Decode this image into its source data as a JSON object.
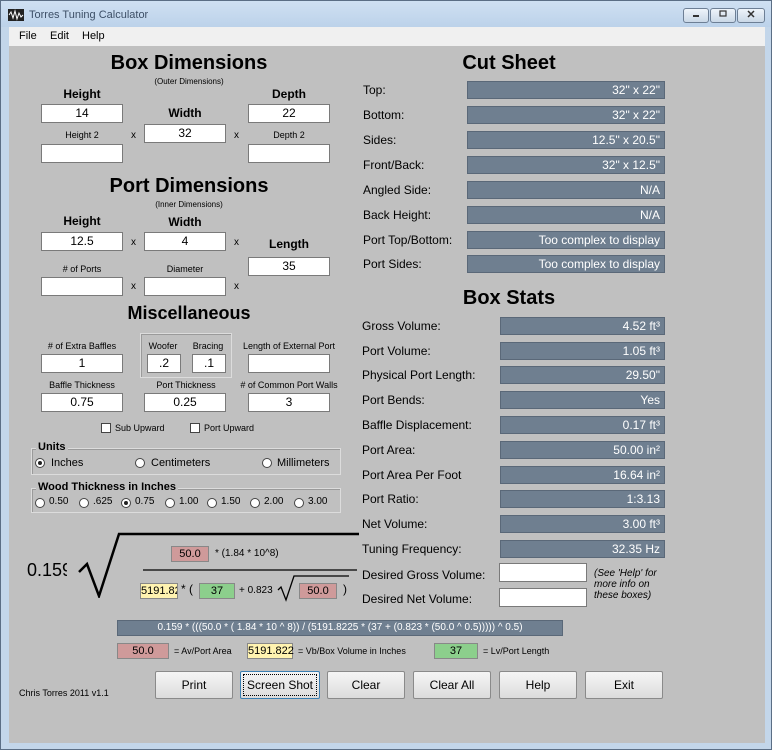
{
  "window": {
    "title": "Torres Tuning Calculator"
  },
  "menu": [
    "File",
    "Edit",
    "Help"
  ],
  "box": {
    "heading": "Box Dimensions",
    "subheading": "(Outer Dimensions)",
    "height_label": "Height",
    "height_value": "14",
    "width_label": "Width",
    "width_value": "32",
    "depth_label": "Depth",
    "depth_value": "22",
    "height2_label": "Height 2",
    "height2_value": "",
    "depth2_label": "Depth 2",
    "depth2_value": ""
  },
  "port": {
    "heading": "Port Dimensions",
    "subheading": "(Inner Dimensions)",
    "height_label": "Height",
    "height_value": "12.5",
    "width_label": "Width",
    "width_value": "4",
    "length_label": "Length",
    "length_value": "35",
    "num_ports_label": "# of Ports",
    "num_ports_value": "",
    "diameter_label": "Diameter",
    "diameter_value": ""
  },
  "misc": {
    "heading": "Miscellaneous",
    "extra_baffles_label": "# of Extra Baffles",
    "extra_baffles_value": "1",
    "woofer_label": "Woofer",
    "woofer_value": ".2",
    "bracing_label": "Bracing",
    "bracing_value": ".1",
    "ext_port_label": "Length of External Port",
    "ext_port_value": "",
    "baffle_thick_label": "Baffle Thickness",
    "baffle_thick_value": "0.75",
    "port_thick_label": "Port Thickness",
    "port_thick_value": "0.25",
    "common_walls_label": "# of Common Port Walls",
    "common_walls_value": "3",
    "sub_upward": "Sub Upward",
    "port_upward": "Port Upward"
  },
  "units": {
    "title": "Units",
    "options": [
      "Inches",
      "Centimeters",
      "Millimeters"
    ],
    "selected": "Inches"
  },
  "wood": {
    "title": "Wood Thickness in Inches",
    "options": [
      "0.50",
      ".625",
      "0.75",
      "1.00",
      "1.50",
      "2.00",
      "3.00"
    ],
    "selected": "0.75"
  },
  "formula": {
    "coef": "0.159",
    "av": "50.0",
    "const_text": "* (1.84 * 10^8)",
    "vb": "5191.822",
    "lv": "37",
    "mid_text": "+ 0.823",
    "av2": "50.0",
    "expression": "0.159 * (((50.0 * ( 1.84 * 10 ^ 8)) / (5191.8225 * (37 + (0.823 * (50.0 ^ 0.5))))) ^ 0.5)",
    "legend_av": "= Av/Port Area",
    "legend_vb": "= Vb/Box Volume in Inches",
    "legend_lv": "= Lv/Port Length"
  },
  "cut_sheet": {
    "heading": "Cut Sheet",
    "rows": [
      {
        "label": "Top:",
        "value": "32\" x 22\""
      },
      {
        "label": "Bottom:",
        "value": "32\" x 22\""
      },
      {
        "label": "Sides:",
        "value": "12.5\" x 20.5\""
      },
      {
        "label": "Front/Back:",
        "value": "32\" x 12.5\""
      },
      {
        "label": "Angled Side:",
        "value": "N/A"
      },
      {
        "label": "Back Height:",
        "value": "N/A"
      },
      {
        "label": "Port Top/Bottom:",
        "value": "Too complex to display"
      },
      {
        "label": "Port Sides:",
        "value": "Too complex to display"
      }
    ]
  },
  "box_stats": {
    "heading": "Box Stats",
    "rows": [
      {
        "label": "Gross Volume:",
        "value": "4.52 ft³"
      },
      {
        "label": "Port Volume:",
        "value": "1.05 ft³"
      },
      {
        "label": "Physical Port Length:",
        "value": "29.50\""
      },
      {
        "label": "Port Bends:",
        "value": "Yes"
      },
      {
        "label": "Baffle Displacement:",
        "value": "0.17 ft³"
      },
      {
        "label": "Port Area:",
        "value": "50.00 in²"
      },
      {
        "label": "Port Area Per Foot",
        "value": "16.64 in²"
      },
      {
        "label": "Port Ratio:",
        "value": "1:3.13"
      },
      {
        "label": "Net Volume:",
        "value": "3.00 ft³"
      },
      {
        "label": "Tuning Frequency:",
        "value": "32.35 Hz"
      }
    ],
    "desired_gross_label": "Desired Gross Volume:",
    "desired_net_label": "Desired Net Volume:",
    "desired_gross_value": "",
    "desired_net_value": "",
    "help_note": "(See 'Help' for more info on these boxes)"
  },
  "footer": {
    "credit": "Chris Torres 2011 v1.1",
    "buttons": [
      "Print",
      "Screen Shot",
      "Clear",
      "Clear All",
      "Help",
      "Exit"
    ]
  }
}
